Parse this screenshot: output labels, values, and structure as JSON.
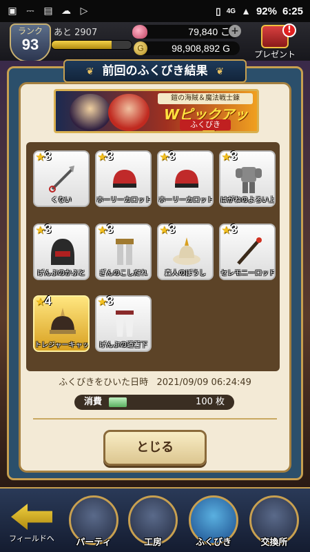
{
  "status_bar": {
    "network": "4G",
    "battery": "92%",
    "time": "6:25"
  },
  "player": {
    "rank_label": "ランク",
    "rank": "93",
    "exp_remaining_label": "あと 2907",
    "exp_progress": 0.75,
    "gems": "79,840 こ",
    "gold": "98,908,892 G",
    "gold_symbol": "G"
  },
  "present": {
    "label": "プレゼント",
    "badge": "!"
  },
  "dialog": {
    "title": "前回のふくびき結果",
    "banner": {
      "subtitle": "鎧の海賊＆魔法戦士錬",
      "main": "Wピックアップ",
      "tag": "ふくびき"
    },
    "items": [
      {
        "stars": "3",
        "name": "くない",
        "icon": "kunai-icon",
        "gold": false
      },
      {
        "stars": "3",
        "name": "ホーリーカロット",
        "icon": "cap-icon",
        "gold": false
      },
      {
        "stars": "3",
        "name": "ホーリーカロット",
        "icon": "cap-icon",
        "gold": false
      },
      {
        "stars": "3",
        "name": "はがねのよろい上",
        "icon": "armor-icon",
        "gold": false
      },
      {
        "stars": "3",
        "name": "げんぶのかぶと",
        "icon": "helmet-icon",
        "gold": false
      },
      {
        "stars": "3",
        "name": "ぎんのこしだれ",
        "icon": "leg-armor-icon",
        "gold": false
      },
      {
        "stars": "3",
        "name": "森人のぼうし",
        "icon": "hat-icon",
        "gold": false
      },
      {
        "stars": "3",
        "name": "セレモニーロッド",
        "icon": "rod-icon",
        "gold": false
      },
      {
        "stars": "4",
        "name": "トレジャーキャップ",
        "icon": "spiked-helmet-icon",
        "gold": true
      },
      {
        "stars": "3",
        "name": "げんぶの道着下",
        "icon": "pants-icon",
        "gold": false
      }
    ],
    "date_label": "ふくびきをひいた日時",
    "date_value": "2021/09/09 06:24:49",
    "cost_label": "消費",
    "cost_value": "100 枚",
    "close_label": "とじる"
  },
  "nav": {
    "field_label": "フィールドへ",
    "items": [
      {
        "label": "パーティ",
        "active": false
      },
      {
        "label": "工房",
        "active": false
      },
      {
        "label": "ふくびき",
        "active": true
      },
      {
        "label": "交換所",
        "active": false
      }
    ]
  },
  "colors": {
    "accent_gold": "#c8a050",
    "panel_brown": "#5c4327",
    "parchment": "#f3ead6",
    "star_yellow": "#f4c020"
  }
}
